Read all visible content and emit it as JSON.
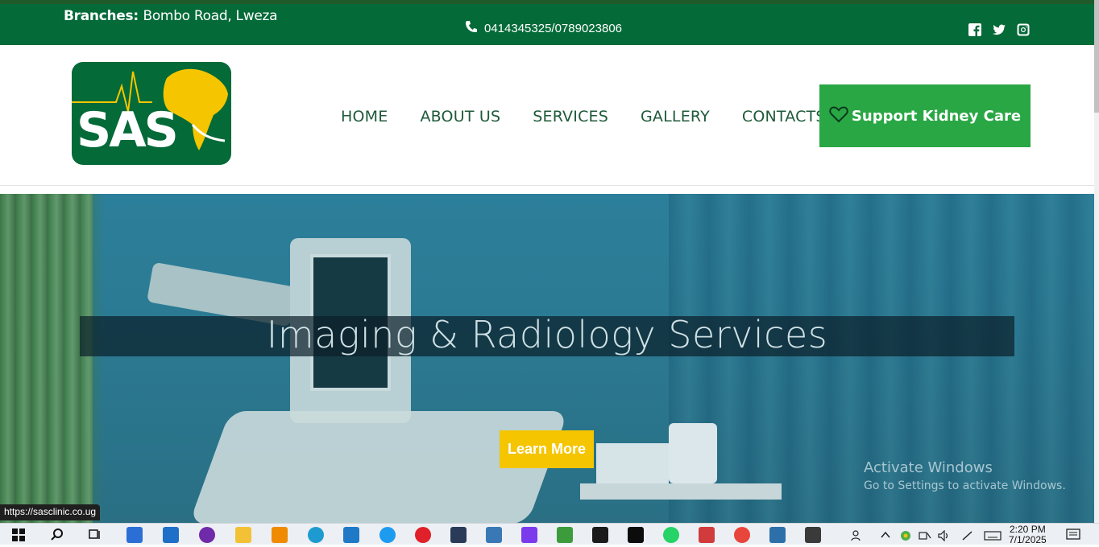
{
  "topbar": {
    "branches_label": "Branches:",
    "branches_value": "Bombo Road, Lweza",
    "phone": "0414345325/0789023806",
    "social": [
      "facebook-icon",
      "twitter-icon",
      "instagram-icon"
    ]
  },
  "logo": {
    "text": "SAS"
  },
  "nav": {
    "items": [
      "HOME",
      "ABOUT US",
      "SERVICES",
      "GALLERY",
      "CONTACTS"
    ],
    "cta": "Support Kidney Care"
  },
  "hero": {
    "title": "Imaging & Radiology Services",
    "button": "Learn More"
  },
  "watermark": {
    "line1": "Activate Windows",
    "line2": "Go to Settings to activate Windows."
  },
  "status_url": "https://sasclinic.co.ug",
  "taskbar": {
    "time": "2:20 PM",
    "date": "7/1/2025"
  },
  "colors": {
    "brand_green": "#046a38",
    "cta_green": "#2aa745",
    "learn_yellow": "#f5c500"
  }
}
